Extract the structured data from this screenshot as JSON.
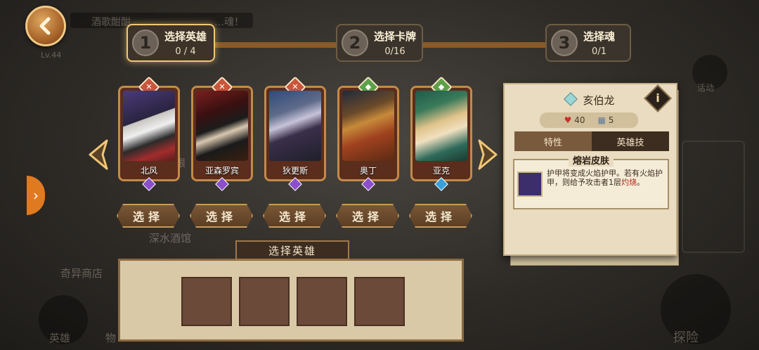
{
  "background": {
    "banner_text": "酒歌酣酣",
    "banner_text_2": "…魂！",
    "level": "Lv.44",
    "tavern": "深水酒馆",
    "shop": "奇异商店",
    "nav_hero": "英雄",
    "nav_item": "物",
    "nav_explore": "探险",
    "nav_other": "活动",
    "label_left": "限"
  },
  "steps": [
    {
      "num": "1",
      "label": "选择英雄",
      "count": "0 / 4"
    },
    {
      "num": "2",
      "label": "选择卡牌",
      "count": "0/16"
    },
    {
      "num": "3",
      "label": "选择魂",
      "count": "0/1"
    }
  ],
  "heroes": [
    {
      "name": "北风",
      "badge_icon": "sword-icon",
      "badge_color": "#c9563c",
      "gem_color": "#8a4fc9"
    },
    {
      "name": "亚森罗宾",
      "badge_icon": "sword-icon",
      "badge_color": "#c9563c",
      "gem_color": "#8a4fc9"
    },
    {
      "name": "狄更斯",
      "badge_icon": "sword-icon",
      "badge_color": "#c9563c",
      "gem_color": "#8a4fc9"
    },
    {
      "name": "奥丁",
      "badge_icon": "shield-icon",
      "badge_color": "#5da04a",
      "gem_color": "#8a4fc9"
    },
    {
      "name": "亚克",
      "badge_icon": "shield-icon",
      "badge_color": "#5da04a",
      "gem_color": "#3aa0d9"
    }
  ],
  "select_label": "选择",
  "detail": {
    "name": "亥伯龙",
    "health": "40",
    "cards": "5",
    "tab_trait": "特性",
    "tab_skill": "英雄技",
    "skill_name": "熔岩皮肤",
    "skill_desc_main": "护甲将变成火焰护甲。若有火焰护甲，则给予攻击者1层",
    "skill_desc_highlight": "灼烧",
    "skill_desc_end": "。"
  },
  "slots": {
    "title": "选择英雄",
    "count": 4
  },
  "colors": {
    "accent_gold": "#f0c777",
    "button_brown": "#7a5736",
    "highlight_red": "#b5281c",
    "side_tab_orange": "#e07a20"
  }
}
